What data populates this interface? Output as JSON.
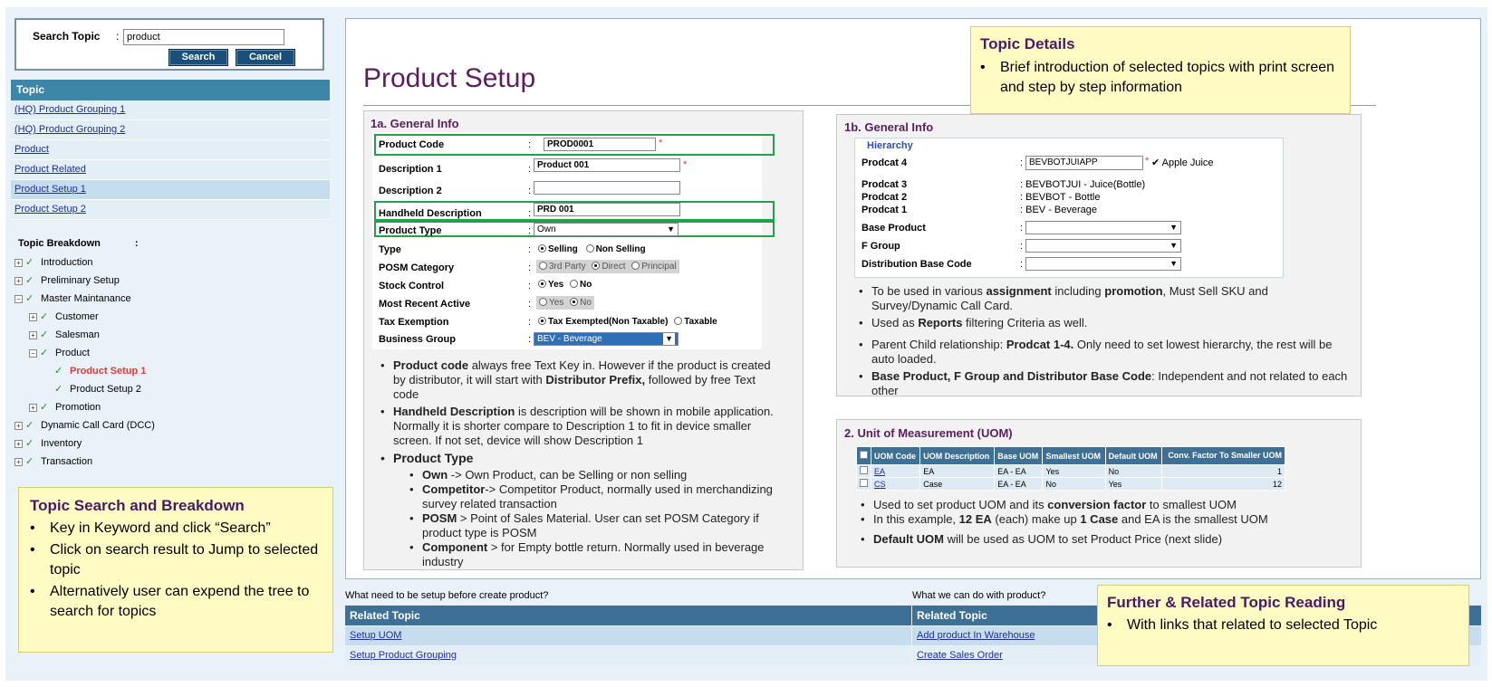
{
  "search": {
    "label": "Search Topic",
    "colon": ":",
    "value": "product",
    "search_btn": "Search",
    "cancel_btn": "Cancel"
  },
  "topics": {
    "header": "Topic",
    "items": [
      {
        "label": "(HQ) Product Grouping 1"
      },
      {
        "label": "(HQ) Product Grouping 2"
      },
      {
        "label": "Product"
      },
      {
        "label": "Product Related"
      },
      {
        "label": "Product Setup 1"
      },
      {
        "label": "Product Setup 2"
      }
    ]
  },
  "breakdown": {
    "title": "Topic Breakdown",
    "colon": ":",
    "nodes": [
      {
        "label": "Introduction"
      },
      {
        "label": "Preliminary Setup"
      },
      {
        "label": "Master Maintanance"
      },
      {
        "label": "Customer"
      },
      {
        "label": "Salesman"
      },
      {
        "label": "Product"
      },
      {
        "label": "Product Setup 1"
      },
      {
        "label": "Product Setup 2"
      },
      {
        "label": "Promotion"
      },
      {
        "label": "Dynamic Call Card (DCC)"
      },
      {
        "label": "Inventory"
      },
      {
        "label": "Transaction"
      }
    ]
  },
  "note_left": {
    "title": "Topic Search and Breakdown",
    "items": [
      "Key in Keyword and click “Search”",
      "Click on search result to Jump to selected topic",
      "Alternatively user can expend the tree to search for topics"
    ]
  },
  "note_topic": {
    "title": "Topic Details",
    "items": [
      "Brief introduction of selected topics with print screen and step by step information"
    ]
  },
  "note_further": {
    "title": "Further & Related Topic Reading",
    "items": [
      "With links that related to selected Topic"
    ]
  },
  "main": {
    "title": "Product Setup",
    "general1": {
      "title": "1a. General Info",
      "labels": [
        "Product Code",
        "Description 1",
        "Description 2",
        "Handheld Description",
        "Product Type",
        "Type",
        "POSM Category",
        "Stock Control",
        "Most Recent Active",
        "Tax Exemption",
        "Business Group"
      ],
      "colon": ":",
      "product_code": "PROD0001",
      "description1": "Product 001",
      "description2": "",
      "handheld": "PRD 001",
      "product_type": "Own",
      "type_opts": [
        "Selling",
        "Non Selling"
      ],
      "posm_opts": [
        "3rd Party",
        "Direct",
        "Principal"
      ],
      "stock_opts": [
        "Yes",
        "No"
      ],
      "recent_opts": [
        "Yes",
        "No"
      ],
      "tax_opts": [
        "Tax Exempted(Non Taxable)",
        "Taxable"
      ],
      "business_group": "BEV - Beverage",
      "req": "*"
    },
    "general1_notes": {
      "b1_bold": "Product code",
      "b1_text": " always free Text Key in. However if the product is created by distributor, it will start with ",
      "b1_bold2": "Distributor Prefix,",
      "b1_text2": " followed by free Text code",
      "b2_bold": "Handheld Description",
      "b2_text": " is description will be shown in mobile application. Normally it is shorter compare to Description 1 to fit in device smaller screen. If not set, device will show Description 1",
      "b3_bold": "Product Type",
      "subs": [
        {
          "bold": "Own",
          "text": " -> Own Product, can be Selling or non selling"
        },
        {
          "bold": "Competitor",
          "text": "-> Competitor Product, normally used in merchandizing survey related transaction"
        },
        {
          "bold": "POSM",
          "text": " > Point of Sales Material. User can set POSM Category if product type is POSM"
        },
        {
          "bold": "Component",
          "text": " > for Empty bottle return. Normally used in beverage industry"
        }
      ]
    },
    "general2": {
      "title": "1b. General Info",
      "hierarchy": "Hierarchy",
      "labels": [
        "Prodcat 4",
        "Prodcat 3",
        "Prodcat 2",
        "Prodcat 1",
        "Base Product",
        "F Group",
        "Distribution Base Code"
      ],
      "colon": ":",
      "prodcat4": "BEVBOTJUIAPP",
      "prodcat4_desc": "Apple Juice",
      "prodcat3": "BEVBOTJUI - Juice(Bottle)",
      "prodcat2": "BEVBOT - Bottle",
      "prodcat1": "BEV - Beverage",
      "req": "*"
    },
    "general2_notes": {
      "b1_a": "To be used in various ",
      "b1_b": "assignment",
      "b1_c": " including ",
      "b1_d": "promotion",
      "b1_e": ", Must Sell SKU and Survey/Dynamic Call Card.",
      "b2_a": "Used as ",
      "b2_b": "Reports",
      "b2_c": " filtering Criteria as well.",
      "b3_a": "Parent Child relationship: ",
      "b3_b": "Prodcat 1-4.",
      "b3_c": " Only need to set lowest hierarchy, the rest will be auto loaded.",
      "b4_b": "Base Product, F Group and Distributor Base Code",
      "b4_c": ": Independent and not related to each other"
    },
    "uom": {
      "title": "2. Unit of Measurement (UOM)",
      "headers": [
        "UOM Code",
        "UOM Description",
        "Base UOM",
        "Smallest UOM",
        "Default UOM",
        "Conv. Factor To Smaller UOM"
      ],
      "rows": [
        [
          "EA",
          "EA",
          "EA - EA",
          "Yes",
          "No",
          "1"
        ],
        [
          "CS",
          "Case",
          "EA - EA",
          "No",
          "Yes",
          "12"
        ]
      ]
    },
    "uom_notes": {
      "b1_a": "Used to set product UOM and its ",
      "b1_b": "conversion factor",
      "b1_c": " to smallest UOM",
      "b2_a": "In this example, ",
      "b2_b": "12 EA",
      "b2_c": " (each) make up ",
      "b2_d": "1 Case",
      "b2_e": " and EA is the smallest UOM",
      "b3_b": "Default UOM",
      "b3_c": " will be used as UOM to set Product Price (next slide)"
    }
  },
  "related": {
    "left_label": "What need to be setup before create product?",
    "right_label": "What we can do with product?",
    "header": "Related Topic",
    "left_links": [
      "Setup UOM",
      "Setup Product Grouping"
    ],
    "right_links": [
      "Add product In Warehouse",
      "Create Sales Order"
    ]
  }
}
